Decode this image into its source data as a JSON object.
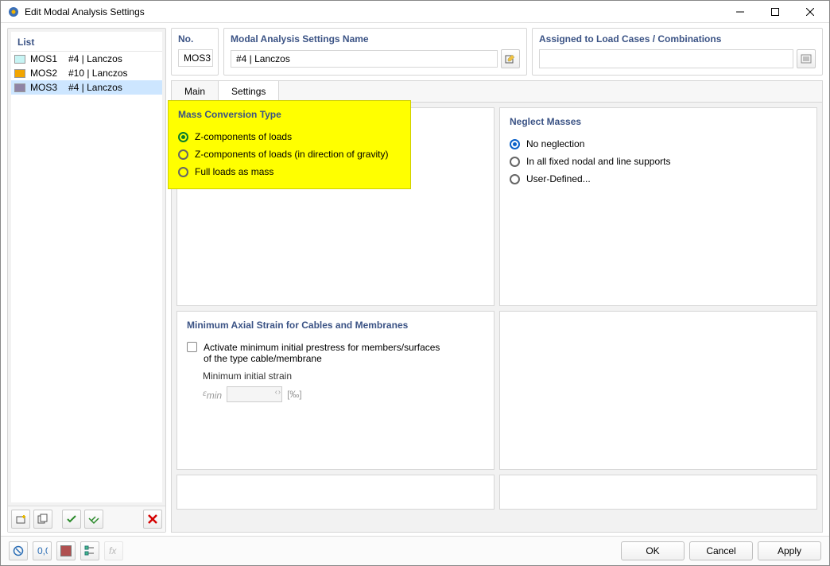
{
  "window": {
    "title": "Edit Modal Analysis Settings"
  },
  "list_panel": {
    "header": "List",
    "items": [
      {
        "id": "MOS1",
        "name": "#4 | Lanczos",
        "color": "#c7f4f4",
        "selected": false
      },
      {
        "id": "MOS2",
        "name": "#10 | Lanczos",
        "color": "#f2a500",
        "selected": false
      },
      {
        "id": "MOS3",
        "name": "#4 | Lanczos",
        "color": "#8f84a5",
        "selected": true
      }
    ]
  },
  "header": {
    "no_label": "No.",
    "no_value": "MOS3",
    "name_label": "Modal Analysis Settings Name",
    "name_value": "#4 | Lanczos",
    "assigned_label": "Assigned to Load Cases / Combinations"
  },
  "tabs": {
    "main": "Main",
    "settings": "Settings"
  },
  "mass_conversion": {
    "title": "Mass Conversion Type",
    "opts": [
      "Z-components of loads",
      "Z-components of loads (in direction of gravity)",
      "Full loads as mass"
    ],
    "selected_index": 0
  },
  "neglect": {
    "title": "Neglect Masses",
    "opts": [
      "No neglection",
      "In all fixed nodal and line supports",
      "User-Defined..."
    ],
    "selected_index": 0
  },
  "min_strain": {
    "title": "Minimum Axial Strain for Cables and Membranes",
    "checkbox": "Activate minimum initial prestress for members/surfaces of the type cable/membrane",
    "label": "Minimum initial strain",
    "symbol": "εmin",
    "unit": "[‰]"
  },
  "buttons": {
    "ok": "OK",
    "cancel": "Cancel",
    "apply": "Apply"
  }
}
